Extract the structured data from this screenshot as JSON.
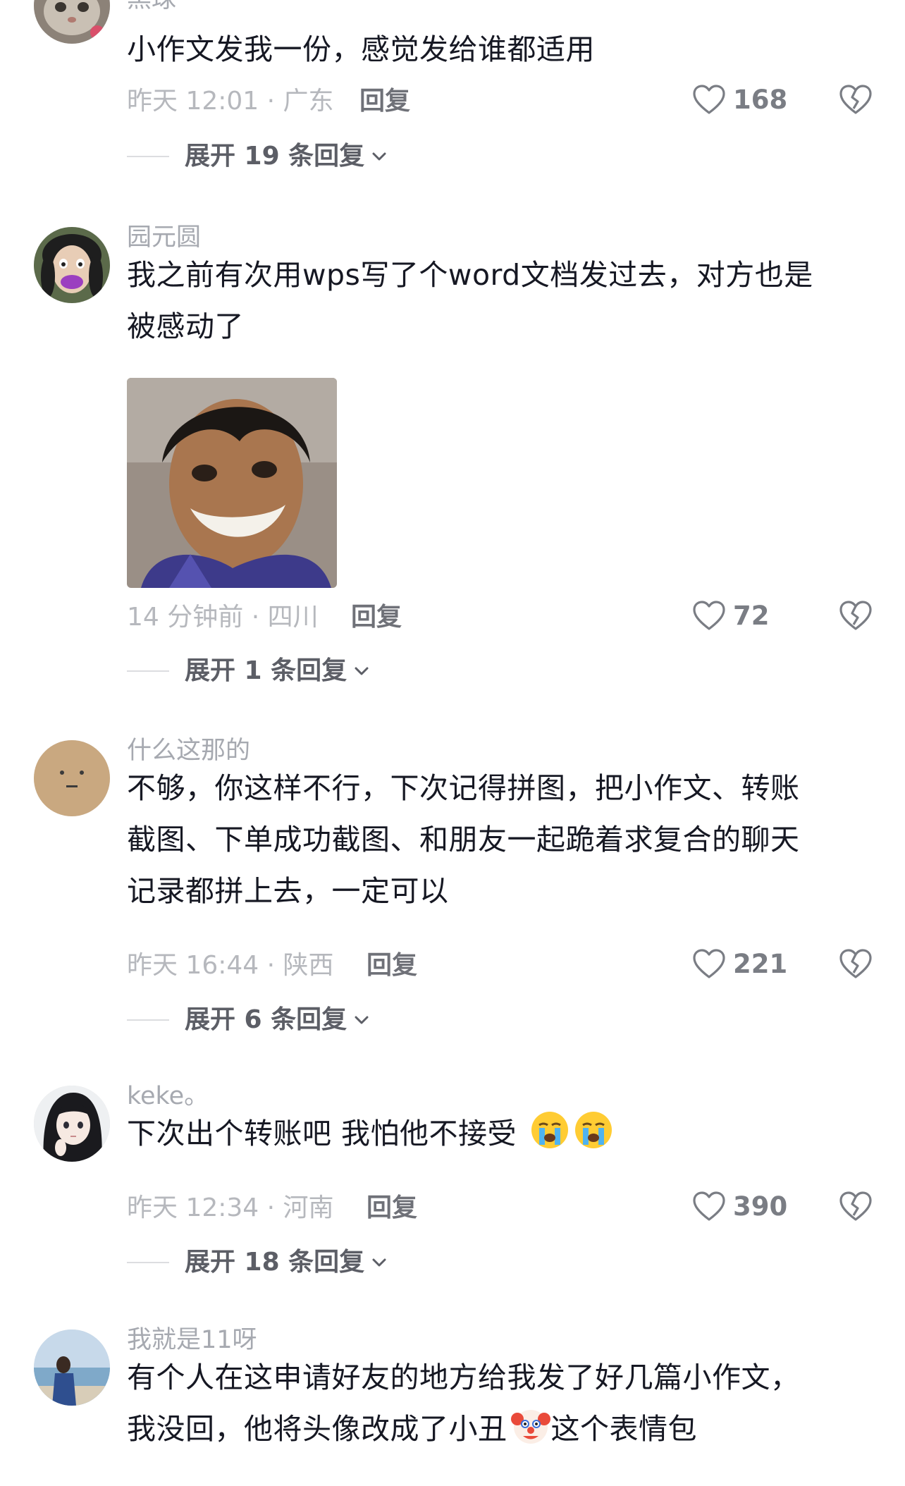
{
  "comments": [
    {
      "username": "黑球",
      "lines": [
        "小作文发我一份，感觉发给谁都适用"
      ],
      "meta": "昨天 12:01 · 广东",
      "reply_label": "回复",
      "likes": "168",
      "expand": "展开 19 条回复",
      "avatar_icon": "cat-avatar-icon"
    },
    {
      "username": "园元圆",
      "lines": [
        "我之前有次用wps写了个word文档发过去，对方也是",
        "被感动了"
      ],
      "meta": "14 分钟前 · 四川",
      "reply_label": "回复",
      "likes": "72",
      "expand": "展开 1 条回复",
      "avatar_icon": "cartoon-face-avatar-icon",
      "sticker_icon": "smiling-person-sticker"
    },
    {
      "username": "什么这那的",
      "lines": [
        "不够，你这样不行，下次记得拼图，把小作文、转账",
        "截图、下单成功截图、和朋友一起跪着求复合的聊天",
        "记录都拼上去，一定可以"
      ],
      "meta": "昨天 16:44 · 陕西",
      "reply_label": "回复",
      "likes": "221",
      "expand": "展开 6 条回复",
      "avatar_icon": "plain-face-avatar-icon"
    },
    {
      "username": "keke。",
      "lines": [
        "下次出个转账吧 我怕他不接受"
      ],
      "emoji_after": [
        "loudly-crying-emoji",
        "loudly-crying-emoji"
      ],
      "meta": "昨天 12:34 · 河南",
      "reply_label": "回复",
      "likes": "390",
      "expand": "展开 18 条回复",
      "avatar_icon": "anime-girl-avatar-icon"
    },
    {
      "username": "我就是11呀",
      "lines": [
        "有个人在这申请好友的地方给我发了好几篇小作文，"
      ],
      "line2_before": "我没回，他将头像改成了小丑",
      "line2_after": "这个表情包",
      "inline_emoji": "clown-face-emoji",
      "avatar_icon": "seaside-person-avatar-icon"
    }
  ],
  "colors": {
    "text_primary": "#161823",
    "text_muted": "#b6b8bd",
    "username": "#a6a9b0",
    "expand": "#5c5e66",
    "icon_stroke": "#7a7d84"
  }
}
